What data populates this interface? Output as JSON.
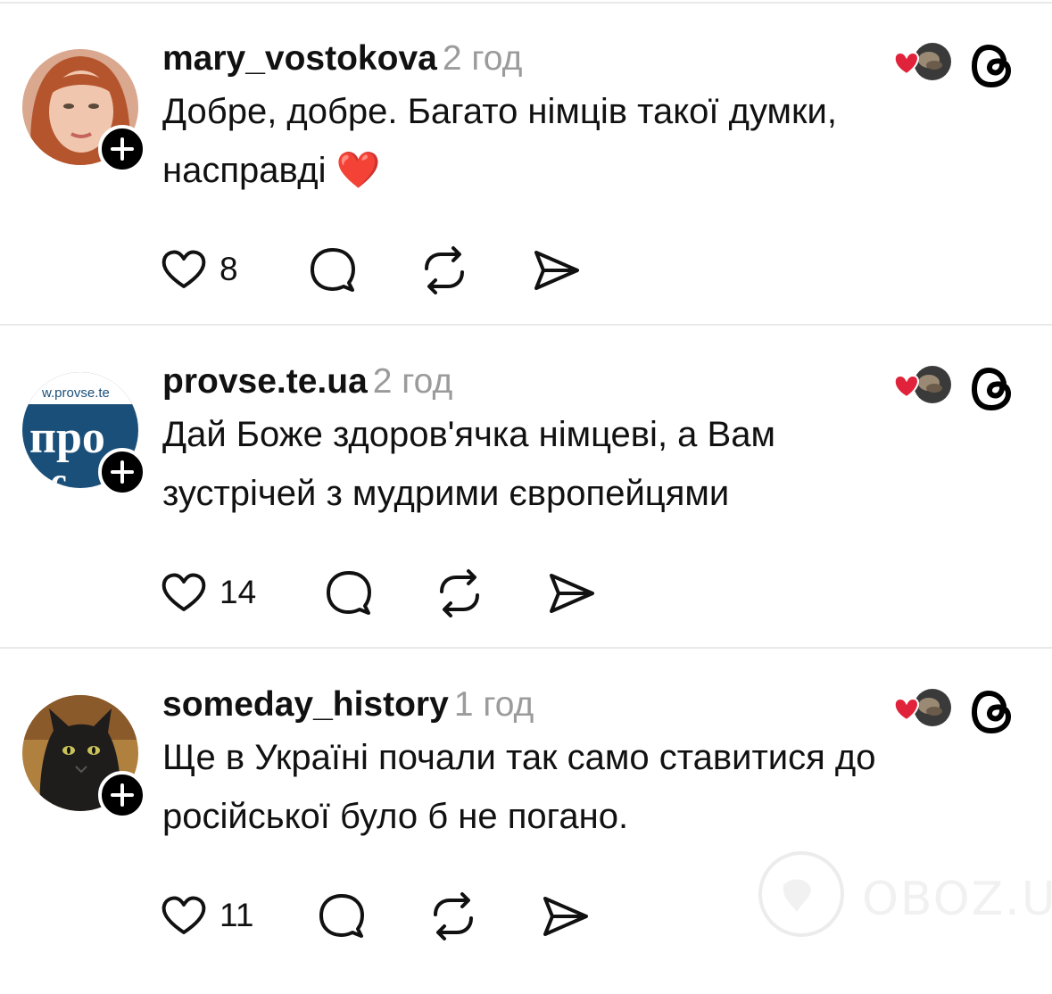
{
  "posts": [
    {
      "username": "mary_vostokova",
      "time": "2 год",
      "line1": "Добре, добре. Багато німців такої думки,",
      "line2": "насправді ❤️",
      "likes": "8",
      "avatar": "woman-portrait"
    },
    {
      "username": "provse.te.ua",
      "time": "2 год",
      "line1": "Дай Боже здоров'ячка німцеві, а Вам",
      "line2": "зустрічей з мудрими європейцями",
      "likes": "14",
      "avatar_top": "w.provse.te",
      "avatar_mid": "про",
      "avatar_bot": "вс",
      "avatar": "provse-logo"
    },
    {
      "username": "someday_history",
      "time": "1 год",
      "line1": "Ще в Україні почали так само ставитися до",
      "line2": "російської було б не погано.",
      "likes": "11",
      "avatar": "black-cat"
    }
  ],
  "icons": {
    "like": "heart-outline-icon",
    "reply": "comment-bubble-icon",
    "repost": "repost-arrows-icon",
    "share": "send-icon",
    "app": "threads-logo-icon",
    "follow": "plus-icon"
  },
  "colors": {
    "text": "#111111",
    "muted": "#9b9b9b",
    "separator": "#e9e9e9",
    "heart": "#e0233a"
  },
  "watermark": "OBOZ.UA"
}
